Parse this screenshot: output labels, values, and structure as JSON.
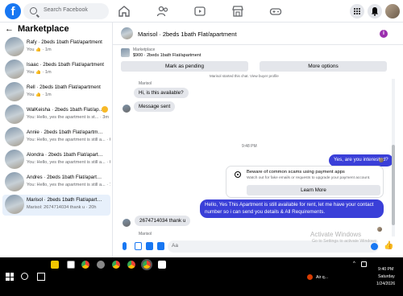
{
  "topbar": {
    "search_placeholder": "Search Facebook",
    "logo_letter": "f"
  },
  "sidebar": {
    "title": "Marketplace",
    "back_glyph": "←",
    "conversations": [
      {
        "title": "Rafy · 2beds 1bath Flat/apartment",
        "preview": "You 👍 · 1m"
      },
      {
        "title": "Isaac · 2beds 1bath Flat/apartment",
        "preview": "You 👍 · 1m"
      },
      {
        "title": "Rell · 2beds 1bath Flat/apartment",
        "preview": "You 👍 · 1m"
      },
      {
        "title": "WalKeisha · 2beds 1bath Flat/apart",
        "preview": "You: Hello, yes the apartment is st... · 3m"
      },
      {
        "title": "Annie · 2beds 1bath Flat/apartment",
        "preview": "You: Hello, yes the apartment is still a... · 6m"
      },
      {
        "title": "Alondra · 2beds 1bath Flat/apartm...",
        "preview": "You: Hello, yes the apartment is still a... · 6m"
      },
      {
        "title": "Andres · 2beds 1bath Flat/apartment",
        "preview": "You: Hello, yes the apartment is still a... · 7m"
      },
      {
        "title": "Marisol · 2beds 1bath Flat/apartm...",
        "preview": "Marisol: 2674714034 thank u · 20h"
      }
    ]
  },
  "chat": {
    "title": "Marisol · 2beds 1bath Flat/apartment",
    "info_glyph": "i",
    "listing": {
      "label": "Marketplace",
      "price": "$900 · 2beds 1bath Flat/apartment"
    },
    "mark_pending": "Mark as pending",
    "more_options": "More options",
    "clipped_note": "Marisol started this chat. View buyer profile",
    "sender_name": "Marisol",
    "sender_name_2": "Marisol",
    "msg1": "Hi, is this available?",
    "msg2": "Message sent",
    "time_sep": "9:48 PM",
    "out1": "Yes, are you interested?",
    "warning": {
      "title": "Beware of common scams using payment apps",
      "subtitle": "Watch out for fake emails or requests to upgrade your payment account.",
      "learn_more": "Learn More"
    },
    "out2": "Hello, Yes This Apartment is still available for rent, let me have your contact number so i can send you details & All Requirements.",
    "in3": "2674714034 thank u",
    "composer_placeholder": "Aa",
    "like_glyph": "👍"
  },
  "watermark": {
    "title": "Activate Windows",
    "subtitle": "Go to Settings to activate Windows."
  },
  "taskbar": {
    "weather": "Air q...",
    "time": "9:40 PM",
    "day": "Saturday",
    "date": "1/24/2026"
  }
}
